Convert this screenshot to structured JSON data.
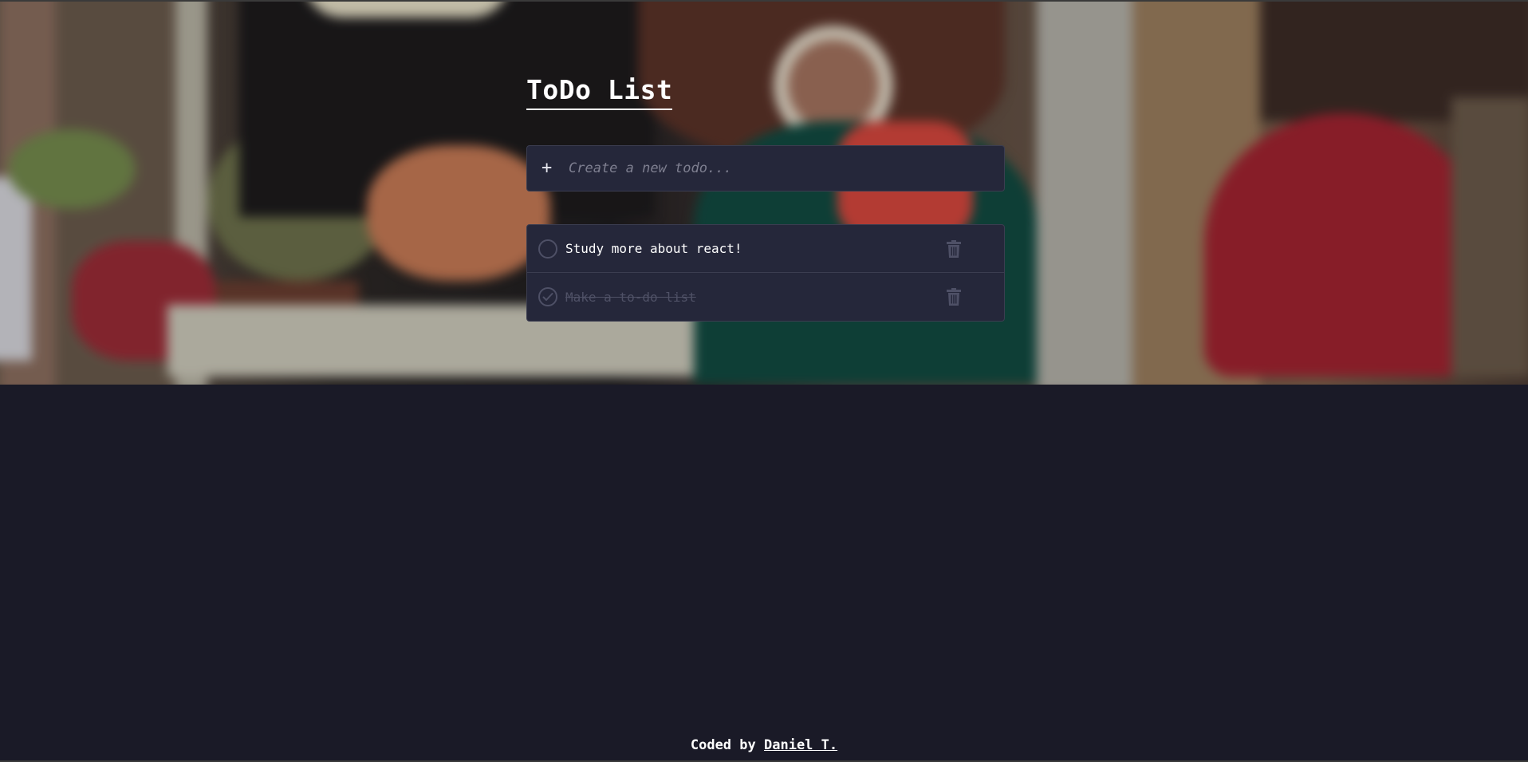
{
  "app": {
    "title": "ToDo List"
  },
  "new_todo": {
    "plus_symbol": "+",
    "placeholder": "Create a new todo...",
    "value": ""
  },
  "todos": [
    {
      "text": "Study more about react!",
      "completed": false
    },
    {
      "text": "Make a to-do list",
      "completed": true
    }
  ],
  "icons": {
    "add": "plus-icon",
    "unchecked": "circle-icon",
    "checked": "check-circle-icon",
    "delete": "trash-icon"
  },
  "footer": {
    "prefix": "Coded by",
    "author_link": "Daniel T."
  },
  "colors": {
    "page_background": "#1a1a27",
    "card_background": "#25273a",
    "card_border": "#3b3d50",
    "text_primary": "#ffffff",
    "text_completed": "#4f5166",
    "placeholder": "#7e7f90",
    "icon_muted": "#4e5066"
  }
}
